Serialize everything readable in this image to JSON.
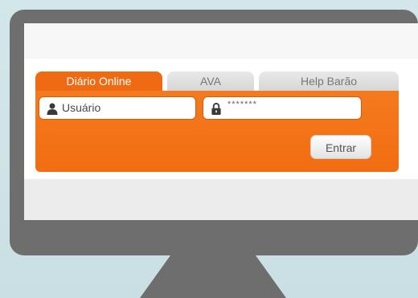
{
  "login": {
    "tabs": [
      {
        "label": "Diário Online",
        "active": true
      },
      {
        "label": "AVA",
        "active": false
      },
      {
        "label": "Help Barão",
        "active": false
      }
    ],
    "username": {
      "placeholder": "Usuário",
      "value": ""
    },
    "password": {
      "value_masked": "*******"
    },
    "enter_label": "Entrar"
  },
  "icons": {
    "user": "user-icon",
    "password": "lock-icon"
  },
  "colors": {
    "accent": "#f26d12",
    "monitor_frame": "#6e6e6e",
    "background": "#d3e7ea"
  }
}
